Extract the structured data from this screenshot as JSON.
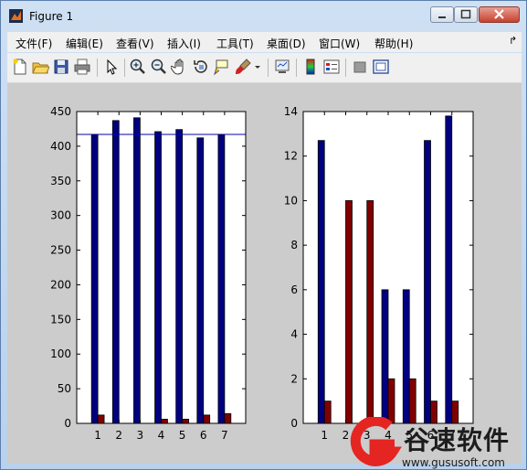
{
  "window": {
    "title": "Figure 1"
  },
  "menu": [
    {
      "label": "文件(F)"
    },
    {
      "label": "编辑(E)"
    },
    {
      "label": "查看(V)"
    },
    {
      "label": "插入(I)"
    },
    {
      "label": "工具(T)"
    },
    {
      "label": "桌面(D)"
    },
    {
      "label": "窗口(W)"
    },
    {
      "label": "帮助(H)"
    }
  ],
  "toolbar": [
    {
      "icon": "new-figure-icon"
    },
    {
      "icon": "open-file-icon"
    },
    {
      "icon": "save-icon"
    },
    {
      "icon": "print-icon"
    },
    {
      "icon": "edit-plot-arrow-icon"
    },
    {
      "icon": "zoom-in-icon"
    },
    {
      "icon": "zoom-out-icon"
    },
    {
      "icon": "pan-hand-icon"
    },
    {
      "icon": "rotate-3d-icon"
    },
    {
      "icon": "data-cursor-icon"
    },
    {
      "icon": "brush-icon"
    },
    {
      "icon": "link-plot-icon"
    },
    {
      "icon": "insert-colorbar-icon"
    },
    {
      "icon": "insert-legend-icon"
    },
    {
      "icon": "hide-plot-tools-icon"
    },
    {
      "icon": "show-plot-tools-icon"
    }
  ],
  "chart_data": [
    {
      "type": "bar",
      "categories": [
        "1",
        "2",
        "3",
        "4",
        "5",
        "6",
        "7"
      ],
      "series": [
        {
          "values": [
            416,
            437,
            441,
            421,
            424,
            412,
            416
          ],
          "color": "#000080"
        },
        {
          "values": [
            12,
            0,
            0,
            6,
            6,
            12,
            14
          ],
          "color": "#800000"
        }
      ],
      "reference_line": {
        "y": 417,
        "color": "#0000aa"
      },
      "ylim": [
        0,
        450
      ],
      "yticks": [
        "0",
        "50",
        "100",
        "150",
        "200",
        "250",
        "300",
        "350",
        "400",
        "450"
      ],
      "xlabel": "",
      "ylabel": "",
      "title": ""
    },
    {
      "type": "bar",
      "categories": [
        "1",
        "2",
        "3",
        "4",
        "5",
        "6",
        "7"
      ],
      "series": [
        {
          "values": [
            12.7,
            0,
            0,
            6,
            6,
            12.7,
            13.8
          ],
          "color": "#000080"
        },
        {
          "values": [
            1,
            10,
            10,
            2,
            2,
            1,
            1
          ],
          "color": "#800000"
        }
      ],
      "ylim": [
        0,
        14
      ],
      "yticks": [
        "0",
        "2",
        "4",
        "6",
        "8",
        "10",
        "12",
        "14"
      ],
      "xlabel": "",
      "ylabel": "",
      "title": ""
    }
  ],
  "watermark": {
    "brand": "谷速软件",
    "url": "www.gususoft.com"
  }
}
